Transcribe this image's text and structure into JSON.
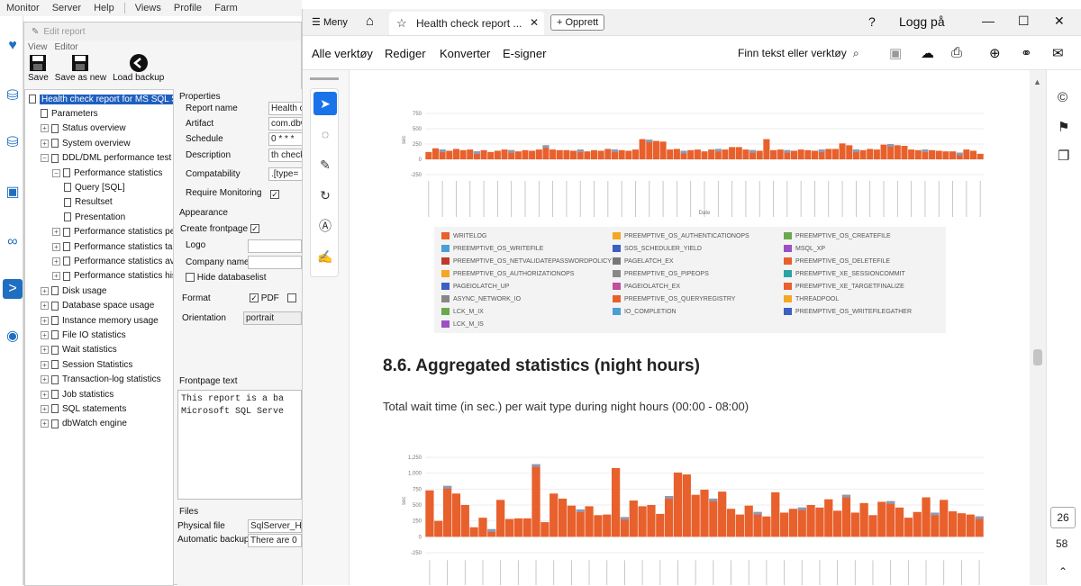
{
  "menubar": {
    "items": [
      "Monitor",
      "Server",
      "Help",
      "Views",
      "Profile",
      "Farm"
    ]
  },
  "editor": {
    "title": "Edit report",
    "menu": [
      "View",
      "Editor"
    ],
    "tools": [
      "Save",
      "Save as new",
      "Load backup"
    ],
    "tree": [
      {
        "label": "Health check report for MS SQL Serv",
        "level": 0,
        "selected": true
      },
      {
        "label": "Parameters",
        "level": 1
      },
      {
        "label": "Status overview",
        "level": 1
      },
      {
        "label": "System overview",
        "level": 1
      },
      {
        "label": "DDL/DML performance test",
        "level": 1
      },
      {
        "label": "Performance statistics",
        "level": 2
      },
      {
        "label": "Query [SQL]",
        "level": 3
      },
      {
        "label": "Resultset",
        "level": 3
      },
      {
        "label": "Presentation",
        "level": 3
      },
      {
        "label": "Performance statistics per 1(",
        "level": 2
      },
      {
        "label": "Performance statistics table",
        "level": 2
      },
      {
        "label": "Performance statistics avg",
        "level": 2
      },
      {
        "label": "Performance statistics histor",
        "level": 2
      },
      {
        "label": "Disk usage",
        "level": 1
      },
      {
        "label": "Database space usage",
        "level": 1
      },
      {
        "label": "Instance memory usage",
        "level": 1
      },
      {
        "label": "File IO statistics",
        "level": 1
      },
      {
        "label": "Wait statistics",
        "level": 1
      },
      {
        "label": "Session Statistics",
        "level": 1
      },
      {
        "label": "Transaction-log statistics",
        "level": 1
      },
      {
        "label": "Job statistics",
        "level": 1
      },
      {
        "label": "SQL statements",
        "level": 1
      },
      {
        "label": "dbWatch engine",
        "level": 1
      }
    ],
    "properties": {
      "header": "Properties",
      "rows": [
        {
          "label": "Report name",
          "value": "Health c"
        },
        {
          "label": "Artifact",
          "value": "com.dbw"
        },
        {
          "label": "Schedule",
          "value": "0 * * *"
        },
        {
          "label": "Description",
          "value": "th check"
        },
        {
          "label": "Compatability",
          "value": ".[type="
        },
        {
          "label": "Require Monitoring",
          "value": "✓"
        }
      ],
      "appearance_header": "Appearance",
      "create_frontpage": "Create frontpage",
      "logo": "Logo",
      "company_name": "Company name",
      "hide_databaselist": "Hide databaselist",
      "format": "Format",
      "format_pdf": "PDF",
      "orientation": "Orientation",
      "orientation_value": "portrait",
      "frontpage_header": "Frontpage text",
      "frontpage_text": "This report is a ba\nMicrosoft SQL Serve",
      "files_header": "Files",
      "physical_file": "Physical file",
      "physical_file_value": "SqlServer_H",
      "automatic_backups": "Automatic backups",
      "automatic_backups_value": "There are 0"
    }
  },
  "pdf": {
    "menu_label": "Meny",
    "tab_title": "Health check report ...",
    "new_tab": "Opprett",
    "login": "Logg på",
    "toolbar": [
      "Alle verktøy",
      "Rediger",
      "Konverter",
      "E-signer"
    ],
    "search": "Finn tekst eller verktøy",
    "section_heading": "8.6. Aggregated statistics (night hours)",
    "paragraph": "Total wait time (in sec.) per wait type during night hours (00:00 - 08:00)",
    "page_current": "26",
    "page_total": "58"
  },
  "chart_data": [
    {
      "type": "bar",
      "ylim": [
        -250,
        750
      ],
      "yticks": [
        "750",
        "500",
        "250",
        "0",
        "-250"
      ],
      "ylabel": "sec",
      "xlabel": "Date",
      "values": [
        120,
        180,
        160,
        140,
        170,
        150,
        160,
        130,
        150,
        120,
        140,
        160,
        150,
        130,
        150,
        140,
        160,
        230,
        160,
        150,
        150,
        140,
        160,
        130,
        150,
        140,
        170,
        160,
        150,
        140,
        160,
        330,
        320,
        300,
        290,
        160,
        170,
        140,
        150,
        160,
        130,
        160,
        170,
        160,
        200,
        200,
        160,
        150,
        140,
        330,
        150,
        160,
        150,
        140,
        160,
        150,
        140,
        160,
        170,
        170,
        260,
        230,
        160,
        150,
        170,
        160,
        240,
        250,
        230,
        220,
        160,
        150,
        160,
        150,
        140,
        130,
        130,
        110,
        160,
        140,
        90
      ],
      "legend": [
        "WRITELOG",
        "PREEMPTIVE_OS_AUTHENTICATIONOPS",
        "PREEMPTIVE_OS_CREATEFILE",
        "PREEMPTIVE_OS_WRITEFILE",
        "SOS_SCHEDULER_YIELD",
        "MSQL_XP",
        "PREEMPTIVE_OS_NETVALIDATEPASSWORDPOLICY",
        "PAGELATCH_EX",
        "PREEMPTIVE_OS_DELETEFILE",
        "PREEMPTIVE_OS_AUTHORIZATIONOPS",
        "PREEMPTIVE_OS_PIPEOPS",
        "PREEMPTIVE_XE_SESSIONCOMMIT",
        "PAGEIOLATCH_UP",
        "PAGEIOLATCH_EX",
        "PREEMPTIVE_XE_TARGETFINALIZE",
        "ASYNC_NETWORK_IO",
        "PREEMPTIVE_OS_QUERYREGISTRY",
        "THREADPOOL",
        "LCK_M_IX",
        "IO_COMPLETION",
        "PREEMPTIVE_OS_WRITEFILEGATHER",
        "LCK_M_IS"
      ],
      "legend_colors": [
        "#e8602c",
        "#f5a623",
        "#6aa84f",
        "#4a9fd4",
        "#3c5fc2",
        "#9c4fc4",
        "#c0392b",
        "#777777",
        "#e8602c",
        "#f5a623",
        "#888888",
        "#2aa3a3",
        "#3c5fc2",
        "#c04f9c",
        "#e8602c",
        "#888888",
        "#e8602c",
        "#f5a623",
        "#6aa84f",
        "#4a9fd4",
        "#3c5fc2",
        "#9c4fc4"
      ]
    },
    {
      "type": "bar",
      "ylim": [
        -250,
        1250
      ],
      "yticks": [
        "1,250",
        "1,000",
        "750",
        "500",
        "250",
        "0",
        "-250"
      ],
      "ylabel": "sec",
      "values": [
        730,
        250,
        800,
        680,
        500,
        150,
        300,
        120,
        580,
        280,
        290,
        290,
        1140,
        230,
        680,
        600,
        490,
        430,
        480,
        340,
        350,
        1080,
        310,
        570,
        480,
        500,
        360,
        640,
        1010,
        980,
        660,
        740,
        600,
        710,
        440,
        350,
        490,
        390,
        320,
        700,
        380,
        440,
        460,
        500,
        460,
        590,
        410,
        660,
        380,
        530,
        340,
        550,
        560,
        460,
        300,
        390,
        620,
        380,
        580,
        400,
        370,
        350,
        320
      ]
    }
  ]
}
